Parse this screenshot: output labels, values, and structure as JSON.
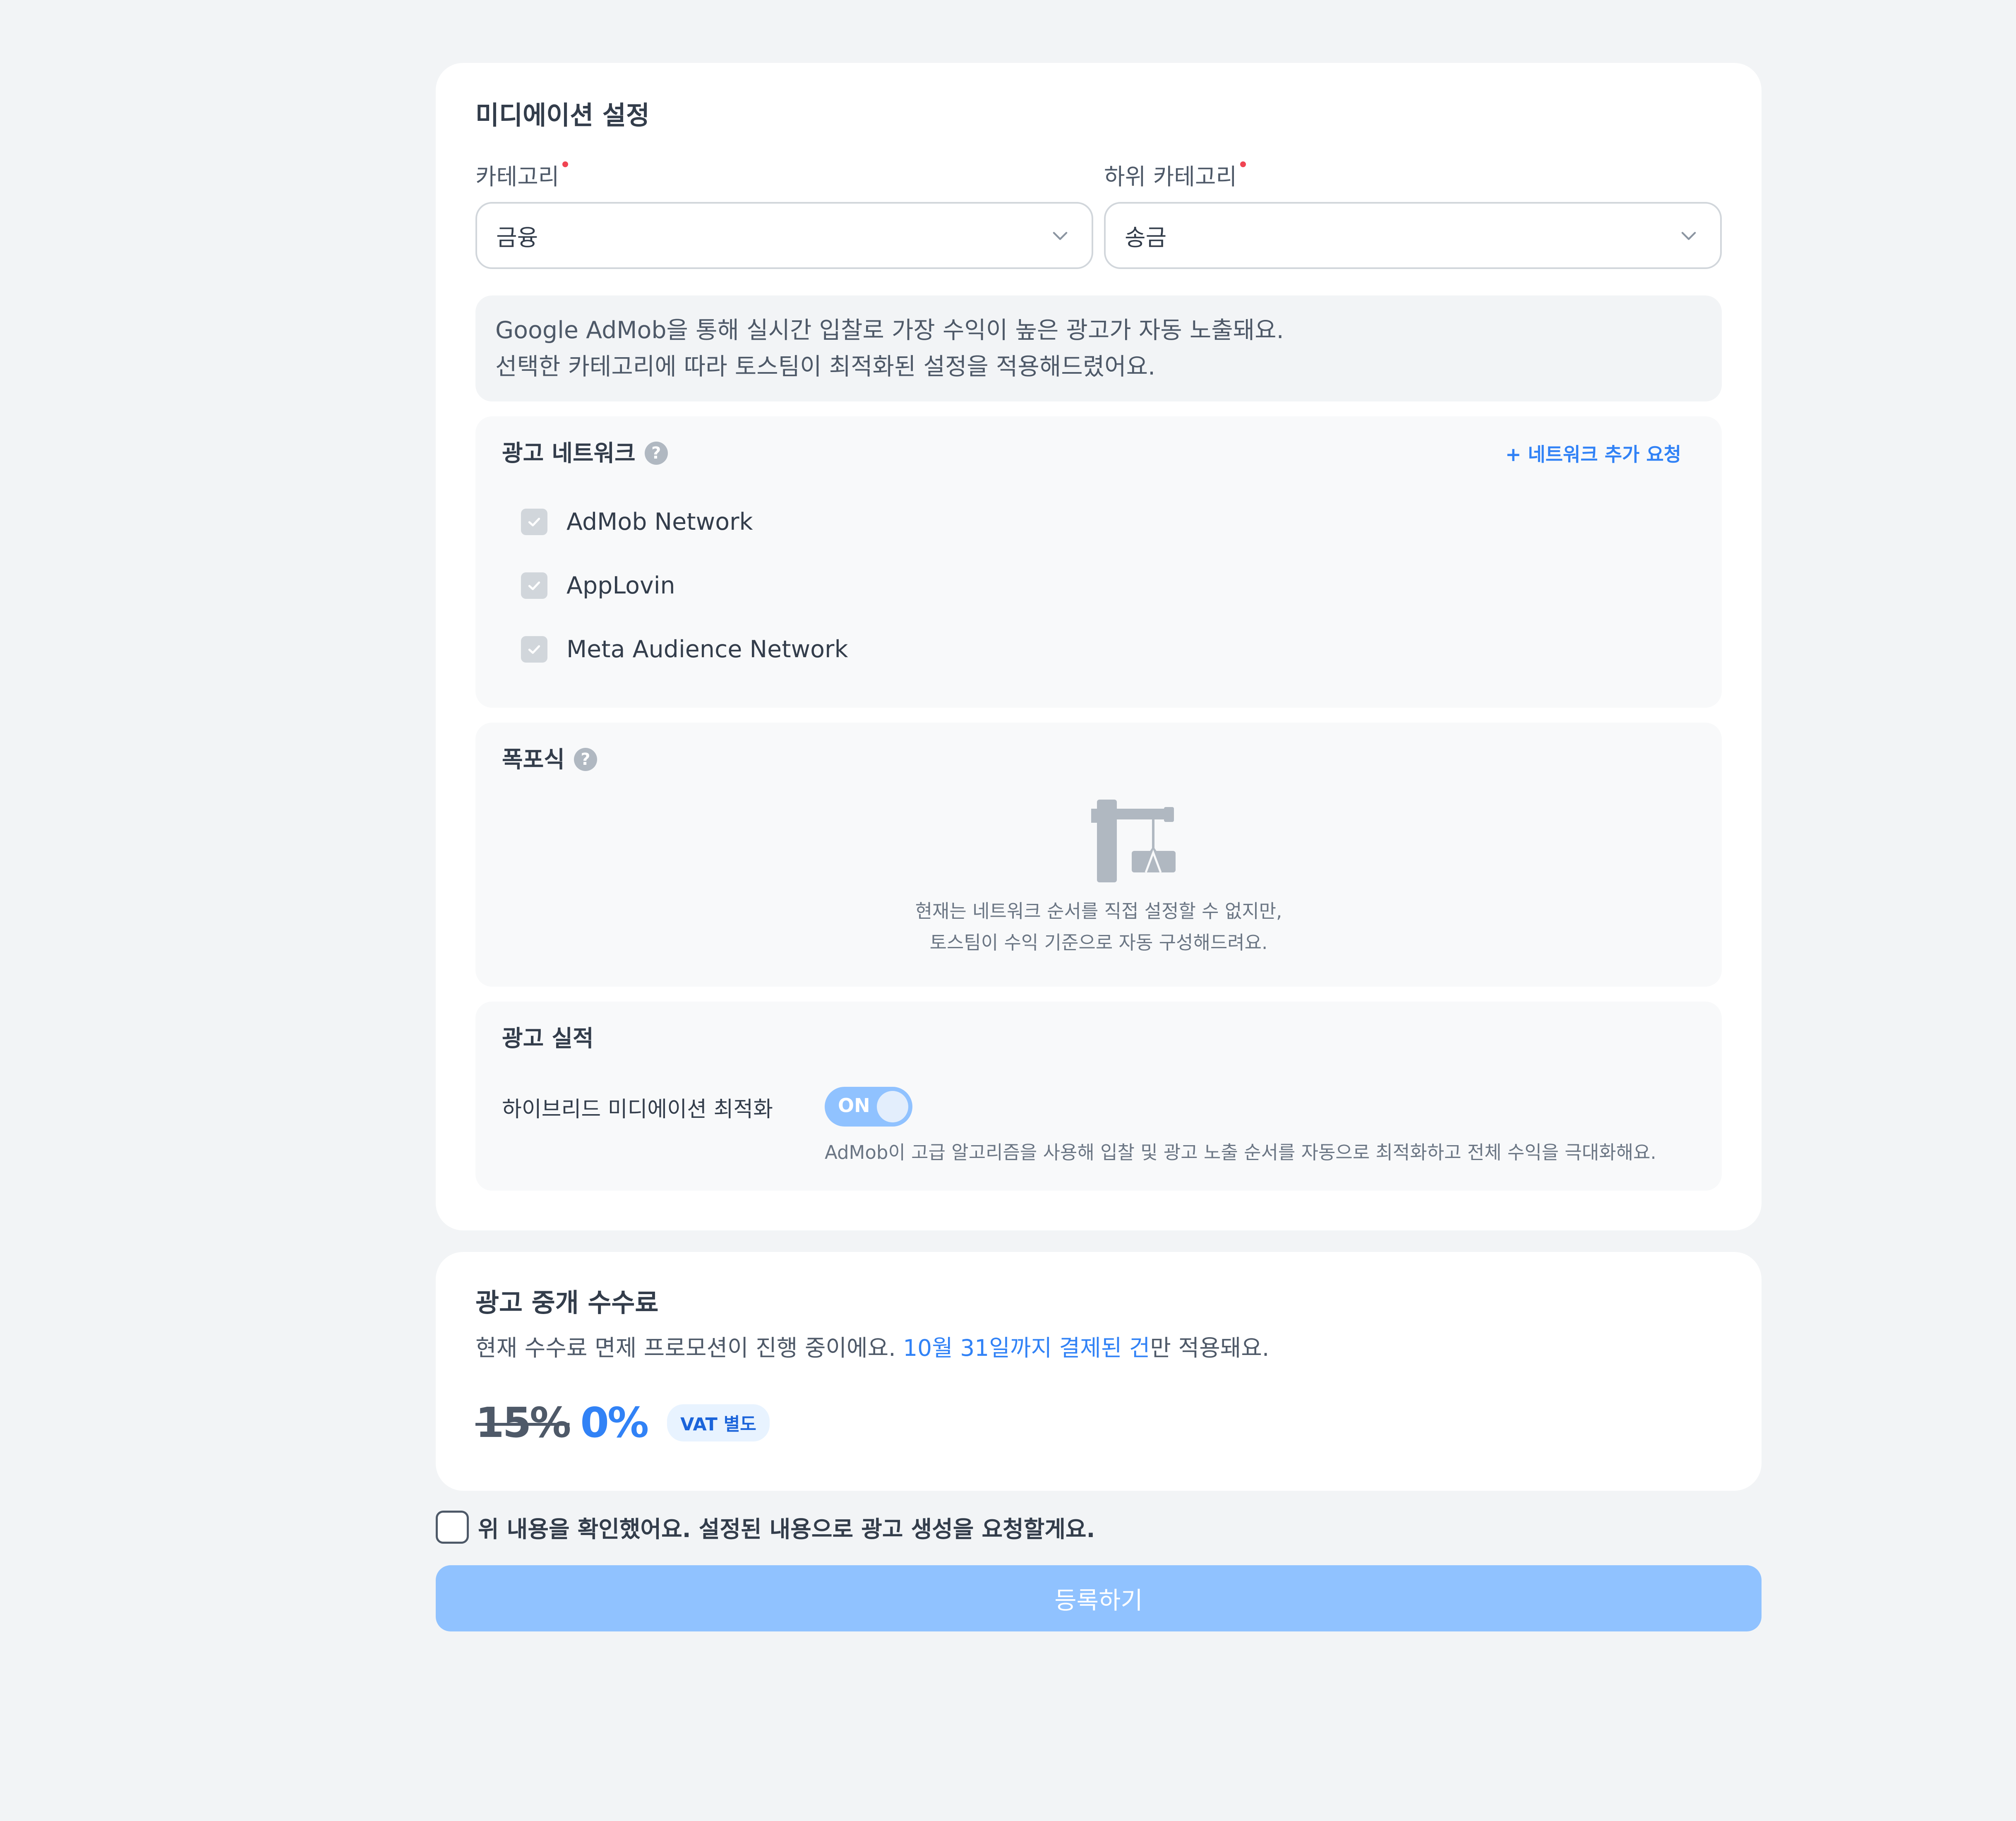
{
  "mediation": {
    "title": "미디에이션 설정",
    "category_label": "카테고리",
    "category_value": "금융",
    "subcategory_label": "하위 카테고리",
    "subcategory_value": "송금",
    "info_line1": "Google AdMob을 통해 실시간 입찰로 가장 수익이 높은 광고가 자동 노출돼요.",
    "info_line2": "선택한 카테고리에 따라 토스팀이 최적화된 설정을 적용해드렸어요.",
    "networks": {
      "title": "광고 네트워크",
      "add_request": "+ 네트워크 추가 요청",
      "items": [
        {
          "label": "AdMob Network",
          "checked": true
        },
        {
          "label": "AppLovin",
          "checked": true
        },
        {
          "label": "Meta Audience Network",
          "checked": true
        }
      ]
    },
    "waterfall": {
      "title": "폭포식",
      "line1": "현재는 네트워크 순서를 직접 설정할 수 없지만,",
      "line2": "토스팀이 수익 기준으로 자동 구성해드려요.",
      "icon": "crane-icon"
    },
    "performance": {
      "title": "광고 실적",
      "hybrid_label": "하이브리드 미디에이션 최적화",
      "toggle_text": "ON",
      "toggle_on": true,
      "description": "AdMob이 고급 알고리즘을 사용해 입찰 및 광고 노출 순서를 자동으로 최적화하고 전체 수익을 극대화해요."
    }
  },
  "fee": {
    "title": "광고 중개 수수료",
    "desc_prefix": "현재 수수료 면제 프로모션이 진행 중이에요. ",
    "desc_highlight": "10월 31일까지 결제된 건",
    "desc_suffix": "만 적용돼요.",
    "old_rate": "15%",
    "new_rate": "0%",
    "vat_badge": "VAT 별도"
  },
  "confirm": {
    "label": "위 내용을 확인했어요. 설정된 내용으로 광고 생성을 요청할게요.",
    "checked": false
  },
  "submit_label": "등록하기",
  "colors": {
    "accent": "#3182f6",
    "button_disabled": "#90c2ff",
    "required": "#f04452",
    "background": "#f2f4f6"
  }
}
